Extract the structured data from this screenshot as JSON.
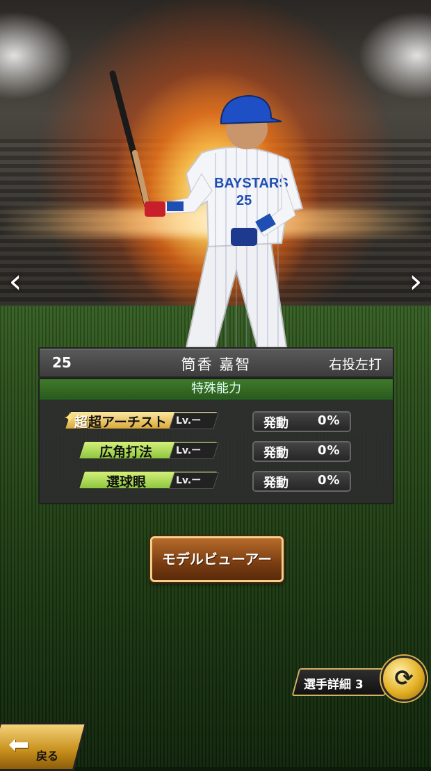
{
  "player": {
    "number": "25",
    "name": "筒香 嘉智",
    "handedness": "右投左打",
    "uniform_number": "25",
    "team_logo_text": "BAYSTARS"
  },
  "nav": {
    "prev_icon": "‹",
    "next_icon": "›"
  },
  "abilities": {
    "header": "特殊能力",
    "items": [
      {
        "name": "超アーチスト",
        "prefix": "超",
        "level": "Lv.ー",
        "activation_label": "発動",
        "rate": "0%",
        "tier": "gold"
      },
      {
        "name": "広角打法",
        "prefix": "",
        "level": "Lv.ー",
        "activation_label": "発動",
        "rate": "0%",
        "tier": "green"
      },
      {
        "name": "選球眼",
        "prefix": "",
        "level": "Lv.ー",
        "activation_label": "発動",
        "rate": "0%",
        "tier": "green"
      }
    ]
  },
  "buttons": {
    "model_viewer": "モデルビューアー",
    "player_detail": "選手詳細 3",
    "back": "戻る"
  },
  "colors": {
    "ability_header": "#2b5a1c",
    "gold_badge": "#d9a93a",
    "green_badge": "#8ec63e",
    "button_brown": "#7a3d12"
  }
}
